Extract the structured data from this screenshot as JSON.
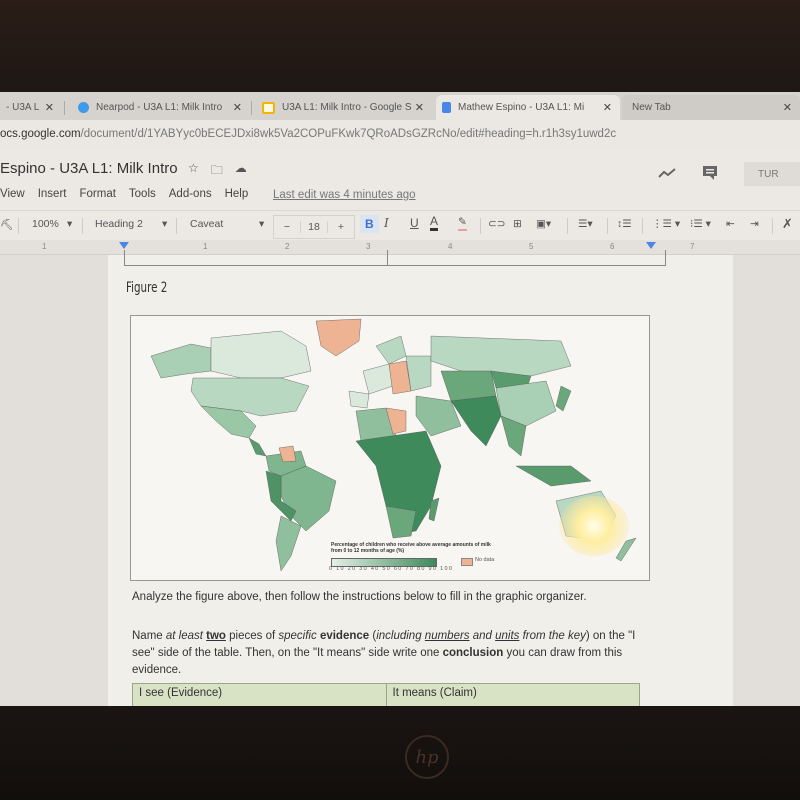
{
  "browser": {
    "tabs": [
      {
        "label": "- U3A L",
        "icon": "docs-icon",
        "active": false
      },
      {
        "label": "Nearpod - U3A L1: Milk Intro",
        "icon": "nearpod-icon",
        "active": false
      },
      {
        "label": "U3A L1: Milk Intro - Google S",
        "icon": "slides-icon",
        "active": false
      },
      {
        "label": "Mathew Espino - U3A L1: Mi",
        "icon": "docs-icon",
        "active": true
      },
      {
        "label": "New Tab",
        "icon": "",
        "active": false
      }
    ],
    "close_glyph": "✕",
    "url_host": "ocs.google.com",
    "url_path": "/document/d/1YABYyc0bECEJDxi8wk5Va2COPuFKwk7QRoADsGZRcNo/edit#heading=h.r1h3sy1uwd2c"
  },
  "docs": {
    "title": "Espino - U3A L1: Milk Intro",
    "menu": [
      "View",
      "Insert",
      "Format",
      "Tools",
      "Add-ons",
      "Help"
    ],
    "last_edit": "Last edit was 4 minutes ago",
    "turn_in_label": "TUR",
    "toolbar": {
      "zoom": "100%",
      "style": "Heading 2",
      "font": "Caveat",
      "font_size": "18",
      "minus": "−",
      "plus": "+",
      "bold": "B",
      "italic": "I",
      "underline": "U",
      "text_color": "A"
    },
    "ruler_numbers": [
      "1",
      "1",
      "2",
      "3",
      "4",
      "5",
      "6",
      "7"
    ]
  },
  "document": {
    "figure_label": "Figure 2",
    "map": {
      "legend_title": "Percentage of children who receive above average amounts of milk from 0 to 12 months of age (%)",
      "legend_ticks": "0 10 20 30 40 50 60 70 80 90 100",
      "no_data_label": "No data",
      "scale_low_color": "#e4efe6",
      "scale_high_color": "#3e8a5a",
      "no_data_color": "#eeb393"
    },
    "instruction_1": "Analyze the figure above, then follow the instructions below to fill in the graphic organizer.",
    "instruction_2": {
      "t1": "Name ",
      "t2": "at least",
      "t3": "two",
      "t4": " pieces of ",
      "t5": "specific",
      "t6": " evidence",
      "t7": " (",
      "t8": "including ",
      "t9": "numbers",
      "t10": " and ",
      "t11": "units",
      "t12": " from the key",
      "t13": ") on the \"I see\" side of the table. Then, on the \"It means\" side write one ",
      "t14": "conclusion",
      "t15": " you can draw from this evidence."
    },
    "table_headers": [
      "I see (Evidence)",
      "It means (Claim)"
    ]
  },
  "device": {
    "brand": "hp"
  }
}
